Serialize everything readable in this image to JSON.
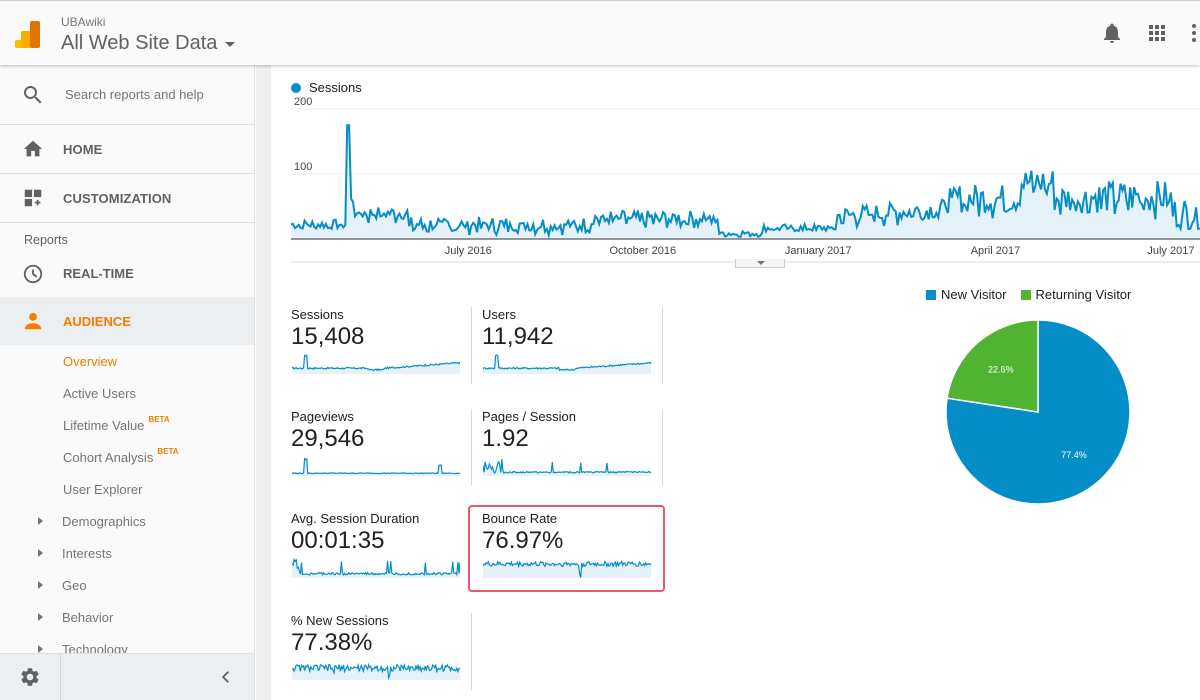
{
  "header": {
    "account": "UBAwiki",
    "property": "All Web Site Data",
    "icons": [
      "bell-icon",
      "apps-grid-icon",
      "more-vert-icon"
    ]
  },
  "sidebar": {
    "search_placeholder": "Search reports and help",
    "home": "HOME",
    "customization": "CUSTOMIZATION",
    "section_reports": "Reports",
    "realtime": "REAL-TIME",
    "audience": "AUDIENCE",
    "audience_items": [
      {
        "label": "Overview",
        "active": true
      },
      {
        "label": "Active Users"
      },
      {
        "label": "Lifetime Value",
        "badge": "BETA"
      },
      {
        "label": "Cohort Analysis",
        "badge": "BETA"
      },
      {
        "label": "User Explorer"
      },
      {
        "label": "Demographics",
        "expandable": true
      },
      {
        "label": "Interests",
        "expandable": true
      },
      {
        "label": "Geo",
        "expandable": true
      },
      {
        "label": "Behavior",
        "expandable": true
      },
      {
        "label": "Technology",
        "expandable": true
      }
    ]
  },
  "colors": {
    "accent": "#f57c00",
    "series_blue": "#058dc7",
    "series_green": "#50b432",
    "highlight": "#e8596d"
  },
  "metrics": [
    {
      "label": "Sessions",
      "value": "15,408"
    },
    {
      "label": "Users",
      "value": "11,942"
    },
    {
      "label": "Pageviews",
      "value": "29,546"
    },
    {
      "label": "Pages / Session",
      "value": "1.92"
    },
    {
      "label": "Avg. Session Duration",
      "value": "00:01:35"
    },
    {
      "label": "Bounce Rate",
      "value": "76.97%",
      "highlighted": true
    },
    {
      "label": "% New Sessions",
      "value": "77.38%"
    }
  ],
  "chart_data": [
    {
      "type": "area",
      "title": "Sessions",
      "legend": [
        "Sessions"
      ],
      "ylim": [
        0,
        200
      ],
      "yticks": [
        "200",
        "100"
      ],
      "xticks": [
        "July 2016",
        "October 2016",
        "January 2017",
        "April 2017",
        "July 2017"
      ],
      "series": [
        {
          "name": "Sessions",
          "description": "daily sessions approx. April 2016 – July 2017",
          "segments": [
            {
              "period": "Apr–May 2016",
              "typical": 18
            },
            {
              "period": "mid-May 2016 spike",
              "peak": 175
            },
            {
              "period": "Jun–Dec 2016",
              "typical": 25,
              "range": [
                5,
                50
              ]
            },
            {
              "period": "late Dec 2016–Jan 2017",
              "typical": 8,
              "range": [
                0,
                15
              ]
            },
            {
              "period": "Feb–Mar 2017",
              "typical": 35,
              "range": [
                15,
                60
              ]
            },
            {
              "period": "Apr–May 2017",
              "typical": 60,
              "range": [
                30,
                115
              ]
            },
            {
              "period": "Jun–Jul 2017",
              "typical": 60,
              "range": [
                25,
                100
              ]
            }
          ]
        }
      ]
    },
    {
      "type": "pie",
      "legend": [
        "New Visitor",
        "Returning Visitor"
      ],
      "slices": [
        {
          "name": "New Visitor",
          "value": 77.4,
          "label": "77.4%",
          "color": "#058dc7"
        },
        {
          "name": "Returning Visitor",
          "value": 22.6,
          "label": "22.6%",
          "color": "#50b432"
        }
      ]
    }
  ]
}
